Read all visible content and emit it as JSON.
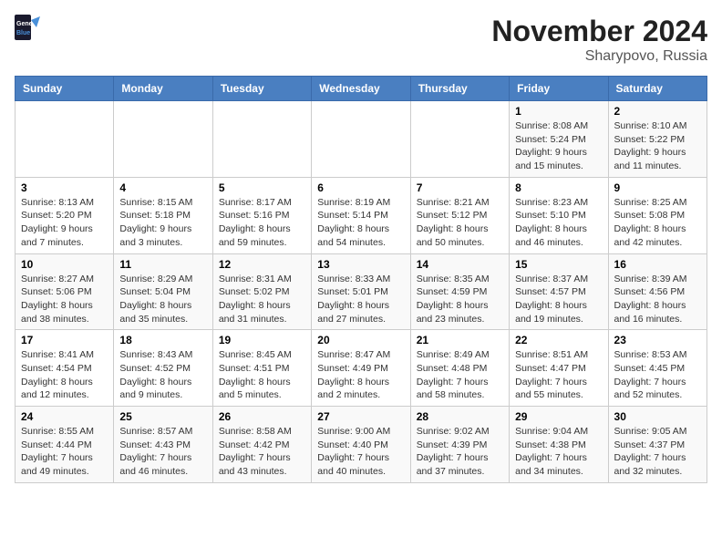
{
  "header": {
    "logo_line1": "General",
    "logo_line2": "Blue",
    "month_title": "November 2024",
    "location": "Sharypovo, Russia"
  },
  "weekdays": [
    "Sunday",
    "Monday",
    "Tuesday",
    "Wednesday",
    "Thursday",
    "Friday",
    "Saturday"
  ],
  "weeks": [
    [
      {
        "day": "",
        "info": ""
      },
      {
        "day": "",
        "info": ""
      },
      {
        "day": "",
        "info": ""
      },
      {
        "day": "",
        "info": ""
      },
      {
        "day": "",
        "info": ""
      },
      {
        "day": "1",
        "info": "Sunrise: 8:08 AM\nSunset: 5:24 PM\nDaylight: 9 hours and 15 minutes."
      },
      {
        "day": "2",
        "info": "Sunrise: 8:10 AM\nSunset: 5:22 PM\nDaylight: 9 hours and 11 minutes."
      }
    ],
    [
      {
        "day": "3",
        "info": "Sunrise: 8:13 AM\nSunset: 5:20 PM\nDaylight: 9 hours and 7 minutes."
      },
      {
        "day": "4",
        "info": "Sunrise: 8:15 AM\nSunset: 5:18 PM\nDaylight: 9 hours and 3 minutes."
      },
      {
        "day": "5",
        "info": "Sunrise: 8:17 AM\nSunset: 5:16 PM\nDaylight: 8 hours and 59 minutes."
      },
      {
        "day": "6",
        "info": "Sunrise: 8:19 AM\nSunset: 5:14 PM\nDaylight: 8 hours and 54 minutes."
      },
      {
        "day": "7",
        "info": "Sunrise: 8:21 AM\nSunset: 5:12 PM\nDaylight: 8 hours and 50 minutes."
      },
      {
        "day": "8",
        "info": "Sunrise: 8:23 AM\nSunset: 5:10 PM\nDaylight: 8 hours and 46 minutes."
      },
      {
        "day": "9",
        "info": "Sunrise: 8:25 AM\nSunset: 5:08 PM\nDaylight: 8 hours and 42 minutes."
      }
    ],
    [
      {
        "day": "10",
        "info": "Sunrise: 8:27 AM\nSunset: 5:06 PM\nDaylight: 8 hours and 38 minutes."
      },
      {
        "day": "11",
        "info": "Sunrise: 8:29 AM\nSunset: 5:04 PM\nDaylight: 8 hours and 35 minutes."
      },
      {
        "day": "12",
        "info": "Sunrise: 8:31 AM\nSunset: 5:02 PM\nDaylight: 8 hours and 31 minutes."
      },
      {
        "day": "13",
        "info": "Sunrise: 8:33 AM\nSunset: 5:01 PM\nDaylight: 8 hours and 27 minutes."
      },
      {
        "day": "14",
        "info": "Sunrise: 8:35 AM\nSunset: 4:59 PM\nDaylight: 8 hours and 23 minutes."
      },
      {
        "day": "15",
        "info": "Sunrise: 8:37 AM\nSunset: 4:57 PM\nDaylight: 8 hours and 19 minutes."
      },
      {
        "day": "16",
        "info": "Sunrise: 8:39 AM\nSunset: 4:56 PM\nDaylight: 8 hours and 16 minutes."
      }
    ],
    [
      {
        "day": "17",
        "info": "Sunrise: 8:41 AM\nSunset: 4:54 PM\nDaylight: 8 hours and 12 minutes."
      },
      {
        "day": "18",
        "info": "Sunrise: 8:43 AM\nSunset: 4:52 PM\nDaylight: 8 hours and 9 minutes."
      },
      {
        "day": "19",
        "info": "Sunrise: 8:45 AM\nSunset: 4:51 PM\nDaylight: 8 hours and 5 minutes."
      },
      {
        "day": "20",
        "info": "Sunrise: 8:47 AM\nSunset: 4:49 PM\nDaylight: 8 hours and 2 minutes."
      },
      {
        "day": "21",
        "info": "Sunrise: 8:49 AM\nSunset: 4:48 PM\nDaylight: 7 hours and 58 minutes."
      },
      {
        "day": "22",
        "info": "Sunrise: 8:51 AM\nSunset: 4:47 PM\nDaylight: 7 hours and 55 minutes."
      },
      {
        "day": "23",
        "info": "Sunrise: 8:53 AM\nSunset: 4:45 PM\nDaylight: 7 hours and 52 minutes."
      }
    ],
    [
      {
        "day": "24",
        "info": "Sunrise: 8:55 AM\nSunset: 4:44 PM\nDaylight: 7 hours and 49 minutes."
      },
      {
        "day": "25",
        "info": "Sunrise: 8:57 AM\nSunset: 4:43 PM\nDaylight: 7 hours and 46 minutes."
      },
      {
        "day": "26",
        "info": "Sunrise: 8:58 AM\nSunset: 4:42 PM\nDaylight: 7 hours and 43 minutes."
      },
      {
        "day": "27",
        "info": "Sunrise: 9:00 AM\nSunset: 4:40 PM\nDaylight: 7 hours and 40 minutes."
      },
      {
        "day": "28",
        "info": "Sunrise: 9:02 AM\nSunset: 4:39 PM\nDaylight: 7 hours and 37 minutes."
      },
      {
        "day": "29",
        "info": "Sunrise: 9:04 AM\nSunset: 4:38 PM\nDaylight: 7 hours and 34 minutes."
      },
      {
        "day": "30",
        "info": "Sunrise: 9:05 AM\nSunset: 4:37 PM\nDaylight: 7 hours and 32 minutes."
      }
    ]
  ]
}
